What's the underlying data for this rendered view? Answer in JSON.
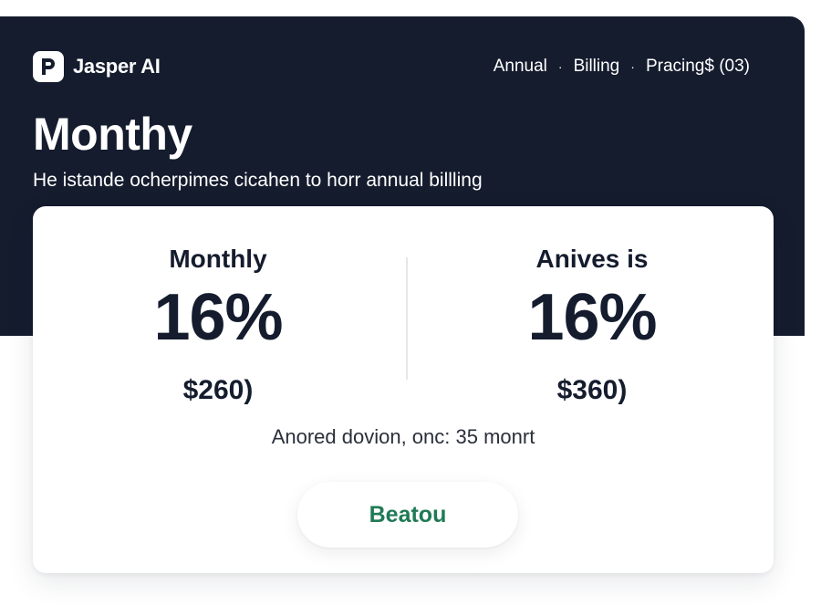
{
  "brand": {
    "name": "Jasper AI",
    "logo_icon": "jasper-p-logo-icon"
  },
  "nav": {
    "items": [
      "Annual",
      "Billing",
      "Pracing$ (03)"
    ],
    "separator": "·"
  },
  "hero": {
    "title": "Monthy",
    "subtitle": "He istande ocherpimes cicahen to horr annual billling"
  },
  "plans": [
    {
      "label": "Monthly",
      "percent": "16%",
      "price": "$260)"
    },
    {
      "label": "Anives is",
      "percent": "16%",
      "price": "$360)"
    }
  ],
  "note": "Anored dovion,  onc: 35 monrt",
  "cta": {
    "label": "Beatou"
  },
  "colors": {
    "hero_bg": "#151c2e",
    "card_bg": "#ffffff",
    "text_dark": "#151c2e",
    "cta_text": "#1f7a55"
  }
}
